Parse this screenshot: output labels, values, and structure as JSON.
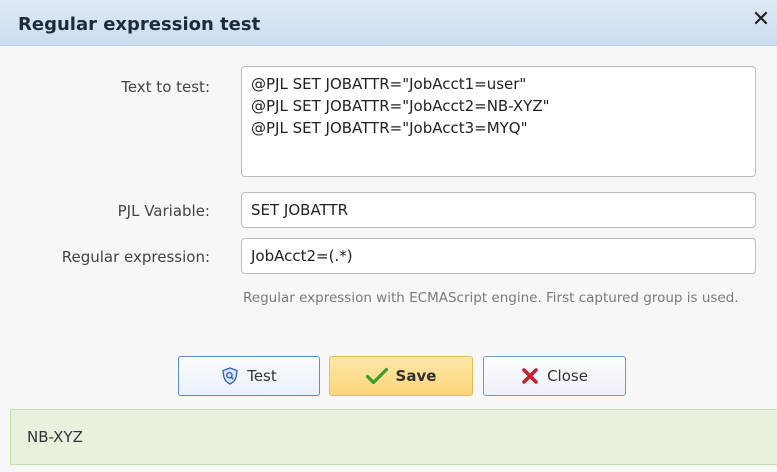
{
  "dialog": {
    "title": "Regular expression test",
    "close_icon": "close-icon"
  },
  "form": {
    "text_to_test_label": "Text to test:",
    "text_to_test_value": "@PJL SET JOBATTR=\"JobAcct1=user\"\n@PJL SET JOBATTR=\"JobAcct2=NB-XYZ\"\n@PJL SET JOBATTR=\"JobAcct3=MYQ\"",
    "pjl_variable_label": "PJL Variable:",
    "pjl_variable_value": "SET JOBATTR",
    "regex_label": "Regular expression:",
    "regex_value": "JobAcct2=(.*)",
    "regex_hint": "Regular expression with ECMAScript engine. First captured group is used."
  },
  "buttons": {
    "test_label": "Test",
    "save_label": "Save",
    "close_label": "Close",
    "test_icon": "shield-search-icon",
    "save_icon": "checkmark-icon",
    "close_icon": "x-icon"
  },
  "result": {
    "value": "NB-XYZ"
  },
  "colors": {
    "title_bar": "#cbdcef",
    "save_button": "#fcd57a",
    "result_background": "#e8f1de",
    "check_green": "#3a9b2f",
    "close_red": "#c8202e"
  }
}
